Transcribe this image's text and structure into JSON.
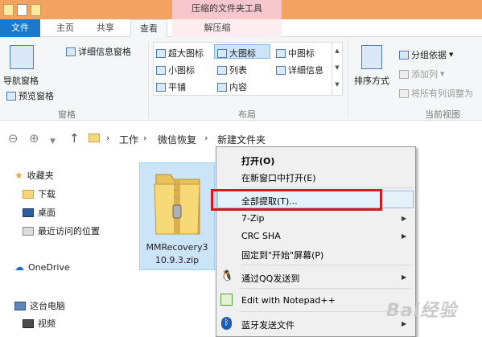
{
  "contextual_tool_title": "压缩的文件夹工具",
  "tabs": {
    "file": "文件",
    "home": "主页",
    "share": "共享",
    "view": "查看",
    "extract": "解压缩"
  },
  "ribbon": {
    "panes": {
      "nav_pane": "导航窗格",
      "preview_pane": "预览窗格",
      "details_pane": "详细信息窗格",
      "group_label": "窗格"
    },
    "layout": {
      "extra_large": "超大图标",
      "large": "大图标",
      "medium": "中图标",
      "small": "小图标",
      "list": "列表",
      "details": "详细信息",
      "tiles": "平铺",
      "content": "内容",
      "group_label": "布局"
    },
    "current_view": {
      "sort_by": "排序方式",
      "group_by": "分组依据",
      "add_columns": "添加列",
      "size_all_columns": "将所有列调整为",
      "group_label": "当前视图"
    }
  },
  "address": {
    "segments": [
      "工作",
      "微信恢复",
      "新建文件夹"
    ],
    "separator": "›"
  },
  "nav_pane": {
    "favorites": "收藏夹",
    "downloads": "下载",
    "desktop": "桌面",
    "recent": "最近访问的位置",
    "onedrive": "OneDrive",
    "this_pc": "这台电脑",
    "videos": "视频"
  },
  "file": {
    "name_line1": "MMRecovery3",
    "name_line2": "10.9.3.zip"
  },
  "context_menu": {
    "open": "打开(O)",
    "open_new_window": "在新窗口中打开(E)",
    "extract_all": "全部提取(T)...",
    "seven_zip": "7-Zip",
    "crc_sha": "CRC SHA",
    "pin_start": "固定到\"开始\"屏幕(P)",
    "send_qq": "通过QQ发送到",
    "edit_notepad": "Edit with Notepad++",
    "bluetooth": "蓝牙发送文件"
  },
  "watermark": "Bai经验",
  "colors": {
    "title_bar": "#f3a262",
    "file_tab": "#1979ca",
    "highlight_box": "#d9161c",
    "selection": "#cce4f7"
  }
}
